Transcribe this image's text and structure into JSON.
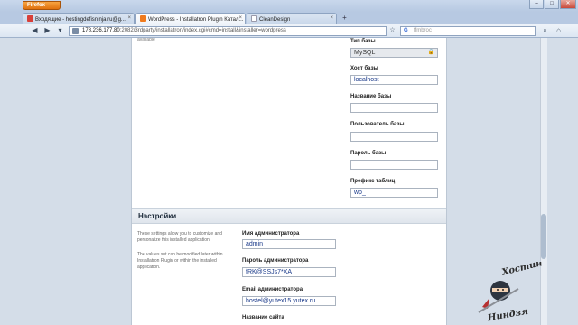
{
  "browser": {
    "menu_button": "Firefox",
    "window_controls": [
      "–",
      "□",
      "✕"
    ],
    "tabs": [
      {
        "label": "Входящие - hostingdefisninja.ru@g...",
        "active": false,
        "icon": "gmail-icon"
      },
      {
        "label": "WordPress - Installatron Plugin Катал...",
        "active": true,
        "icon": "cpanel-icon"
      },
      {
        "label": "CleanDesign",
        "active": false,
        "icon": "blank-page-icon"
      }
    ],
    "new_tab": "+",
    "url_prefix": "178.236.177.80",
    "url_rest": ":2082/3rdparty/installatron/index.cgi#cmd=install&installer=wordpress",
    "search_engine_glyph": "G",
    "search_placeholder": "ffmbroc"
  },
  "form": {
    "available_note": "available",
    "db_type_label": "Тип базы",
    "db_type_value": "MySQL",
    "db_host_label": "Хост базы",
    "db_host_value": "localhost",
    "db_name_label": "Название базы",
    "db_name_value": "",
    "db_user_label": "Пользователь базы",
    "db_user_value": "",
    "db_pass_label": "Пароль базы",
    "db_pass_value": "",
    "table_prefix_label": "Префикс таблиц",
    "table_prefix_value": "wp_"
  },
  "settings": {
    "heading": "Настройки",
    "desc1": "These settings allow you to customize and personalize this installed application.",
    "desc2": "The values set can be modified later within Installatron Plugin or within the installed application.",
    "admin_user_label": "Имя администратора",
    "admin_user_value": "admin",
    "admin_pass_label": "Пароль администратора",
    "admin_pass_value": "fRK@SSJs7*XA",
    "admin_email_label": "Email администратора",
    "admin_email_value": "hostel@yutex15.yutex.ru",
    "site_name_label": "Название сайта"
  },
  "watermark": {
    "line1": "Хостинг",
    "line2": "Ниндзя"
  },
  "colors": {
    "firefox_button": "#e98a1f",
    "section_bg": "#e4e9ef",
    "field_text": "#1a3a8a"
  }
}
